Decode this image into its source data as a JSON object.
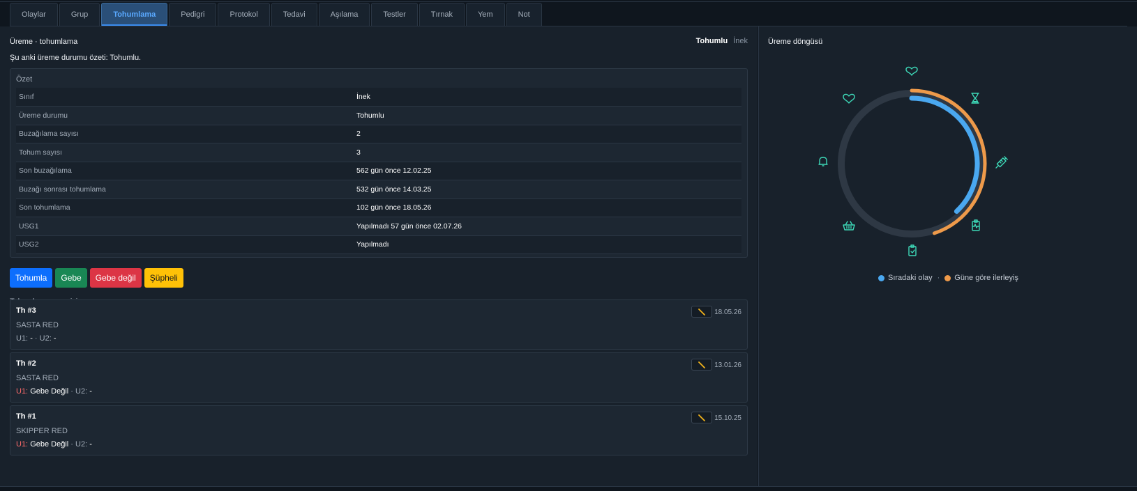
{
  "tabs": [
    "Olaylar",
    "Grup",
    "Tohumlama",
    "Pedigri",
    "Protokol",
    "Tedavi",
    "Aşılama",
    "Testler",
    "Tırnak",
    "Yem",
    "Not"
  ],
  "active_tab": "Tohumlama",
  "header": {
    "title": "Üreme · tohumlama",
    "status_bold": "Tohumlu",
    "status_muted": "İnek",
    "subtitle": "Şu anki üreme durumu özeti: Tohumlu."
  },
  "summary": {
    "title": "Özet",
    "rows": [
      {
        "key": "Sınıf",
        "value": "İnek"
      },
      {
        "key": "Üreme durumu",
        "value": "Tohumlu"
      },
      {
        "key": "Buzağılama sayısı",
        "value": "2"
      },
      {
        "key": "Tohum sayısı",
        "value": "3"
      },
      {
        "key": "Son buzağılama",
        "value": "562 gün önce 12.02.25"
      },
      {
        "key": "Buzağı sonrası tohumlama",
        "value": "532 gün önce 14.03.25"
      },
      {
        "key": "Son tohumlama",
        "value": "102 gün önce 18.05.26"
      },
      {
        "key": "USG1",
        "value": "Yapılmadı 57 gün önce 02.07.26"
      },
      {
        "key": "USG2",
        "value": "Yapılmadı"
      }
    ]
  },
  "actions": {
    "inseminate": "Tohumla",
    "pregnant": "Gebe",
    "not_pregnant": "Gebe değil",
    "suspicious": "Şüpheli"
  },
  "history": {
    "title": "Tohumlama geçmişi",
    "items": [
      {
        "th": "Th #3",
        "bull": "SASTA RED",
        "date": "18.05.26",
        "u1_label": "U1:",
        "u1_value": "-",
        "u2_label": "U2:",
        "u2_value": "-",
        "u1_negative": false
      },
      {
        "th": "Th #2",
        "bull": "SASTA RED",
        "date": "13.01.26",
        "u1_label": "U1:",
        "u1_value": "Gebe Değil",
        "u2_label": "U2:",
        "u2_value": "-",
        "u1_negative": true
      },
      {
        "th": "Th #1",
        "bull": "SKIPPER RED",
        "date": "15.10.25",
        "u1_label": "U1:",
        "u1_value": "Gebe Değil",
        "u2_label": "U2:",
        "u2_value": "-",
        "u1_negative": true
      }
    ]
  },
  "cycle": {
    "title": "Üreme döngüsü",
    "next_event_progress": 0.38,
    "day_progress": 0.45,
    "legend_next": "Sıradaki olay",
    "legend_day": "Güne göre ilerleyiş",
    "colors": {
      "track": "#2e3844",
      "next": "#4aa8f0",
      "day": "#ee9a4a",
      "icon": "#3dd9b8"
    },
    "stage_icons": [
      "heart-icon",
      "hourglass-icon",
      "syringe-icon",
      "clipboard-pulse-icon",
      "clipboard-check-icon",
      "basket-icon",
      "bell-icon",
      "heart-outline-icon"
    ]
  }
}
